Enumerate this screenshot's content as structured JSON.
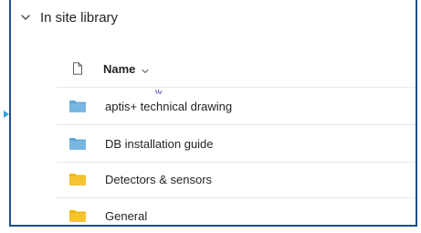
{
  "section": {
    "title": "In site library",
    "icon": "chevron-down-icon"
  },
  "table": {
    "header": {
      "type_icon": "file-icon",
      "name_label": "Name",
      "sort_icon": "chevron-down-icon"
    },
    "rows": [
      {
        "label": "aptis+ technical drawing",
        "icon": "folder-icon",
        "color": "#5ba6dc",
        "new_indicator": true
      },
      {
        "label": "DB installation guide",
        "icon": "folder-icon",
        "color": "#5ba6dc"
      },
      {
        "label": "Detectors & sensors",
        "icon": "folder-icon",
        "color": "#f4b400"
      },
      {
        "label": "General",
        "icon": "folder-icon",
        "color": "#f4b400"
      }
    ]
  },
  "colors": {
    "frame_border": "#1f4e8c",
    "accent_marker": "#2f9fdb",
    "text": "#242424",
    "new_indicator": "#6b4fbb"
  }
}
